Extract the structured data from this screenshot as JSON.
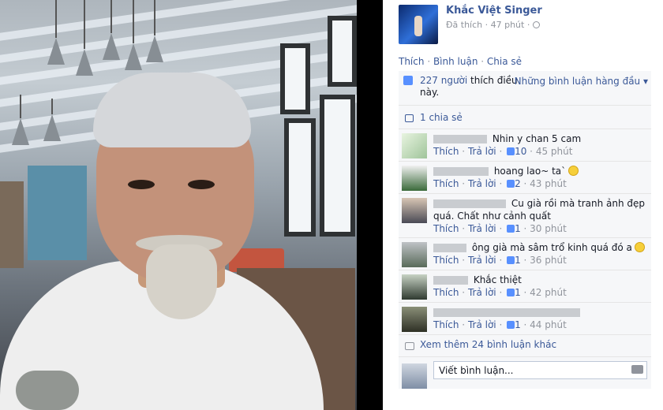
{
  "post": {
    "page_name": "Khắc Việt Singer",
    "meta": "Đã thích · 47 phút ·",
    "actions": [
      "Thích",
      "Bình luận",
      "Chia sẻ"
    ]
  },
  "likes": {
    "count": "227 người",
    "text": " thích điều này.",
    "top_comments": "Những bình luận hàng đầu ▾"
  },
  "share": {
    "text": "1 chia sẻ"
  },
  "comments": [
    {
      "text": "Nhin y chan 5 cam",
      "like": "Thích",
      "reply": "Trả lời",
      "likes": "10",
      "time": "45 phút"
    },
    {
      "text": "hoang lao~ ta`",
      "like": "Thích",
      "reply": "Trả lời",
      "likes": "2",
      "time": "43 phút"
    },
    {
      "text": "Cu già rồi mà tranh ảnh đẹp quá. Chất như cảnh quất",
      "like": "Thích",
      "reply": "Trả lời",
      "likes": "1",
      "time": "30 phút"
    },
    {
      "text": "ông già mà sâm trổ kinh quá đó a",
      "like": "Thích",
      "reply": "Trả lời",
      "likes": "1",
      "time": "36 phút"
    },
    {
      "text": "Khắc thiệt",
      "like": "Thích",
      "reply": "Trả lời",
      "likes": "1",
      "time": "42 phút"
    },
    {
      "text": "",
      "like": "Thích",
      "reply": "Trả lời",
      "likes": "1",
      "time": "44 phút"
    }
  ],
  "more": {
    "text": "Xem thêm 24 bình luận khác"
  },
  "composer": {
    "placeholder": "Viết bình luận..."
  },
  "colors": {
    "link": "#3b5998",
    "meta": "#90949c",
    "ufi_bg": "#f6f7f9"
  },
  "icons": [
    "globe-icon",
    "like-thumb-icon",
    "share-icon",
    "comment-icon",
    "camera-icon",
    "smiley-icon"
  ]
}
